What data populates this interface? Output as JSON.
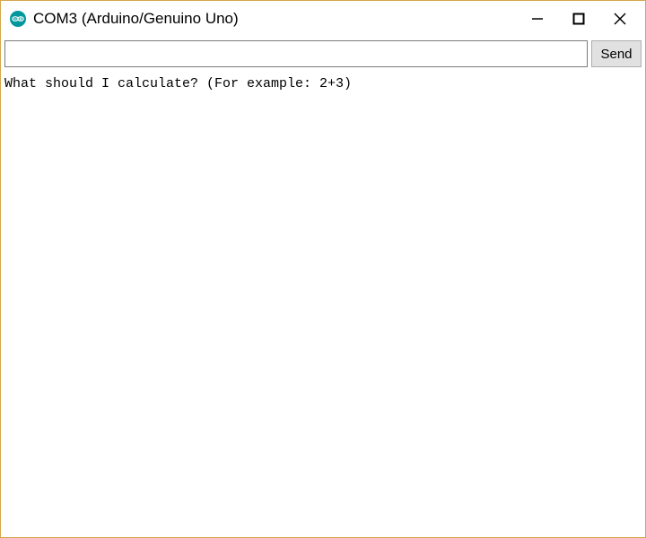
{
  "titlebar": {
    "title": "COM3 (Arduino/Genuino Uno)"
  },
  "input_row": {
    "serial_value": "",
    "send_label": "Send"
  },
  "output": {
    "lines": "What should I calculate? (For example: 2+3)"
  }
}
